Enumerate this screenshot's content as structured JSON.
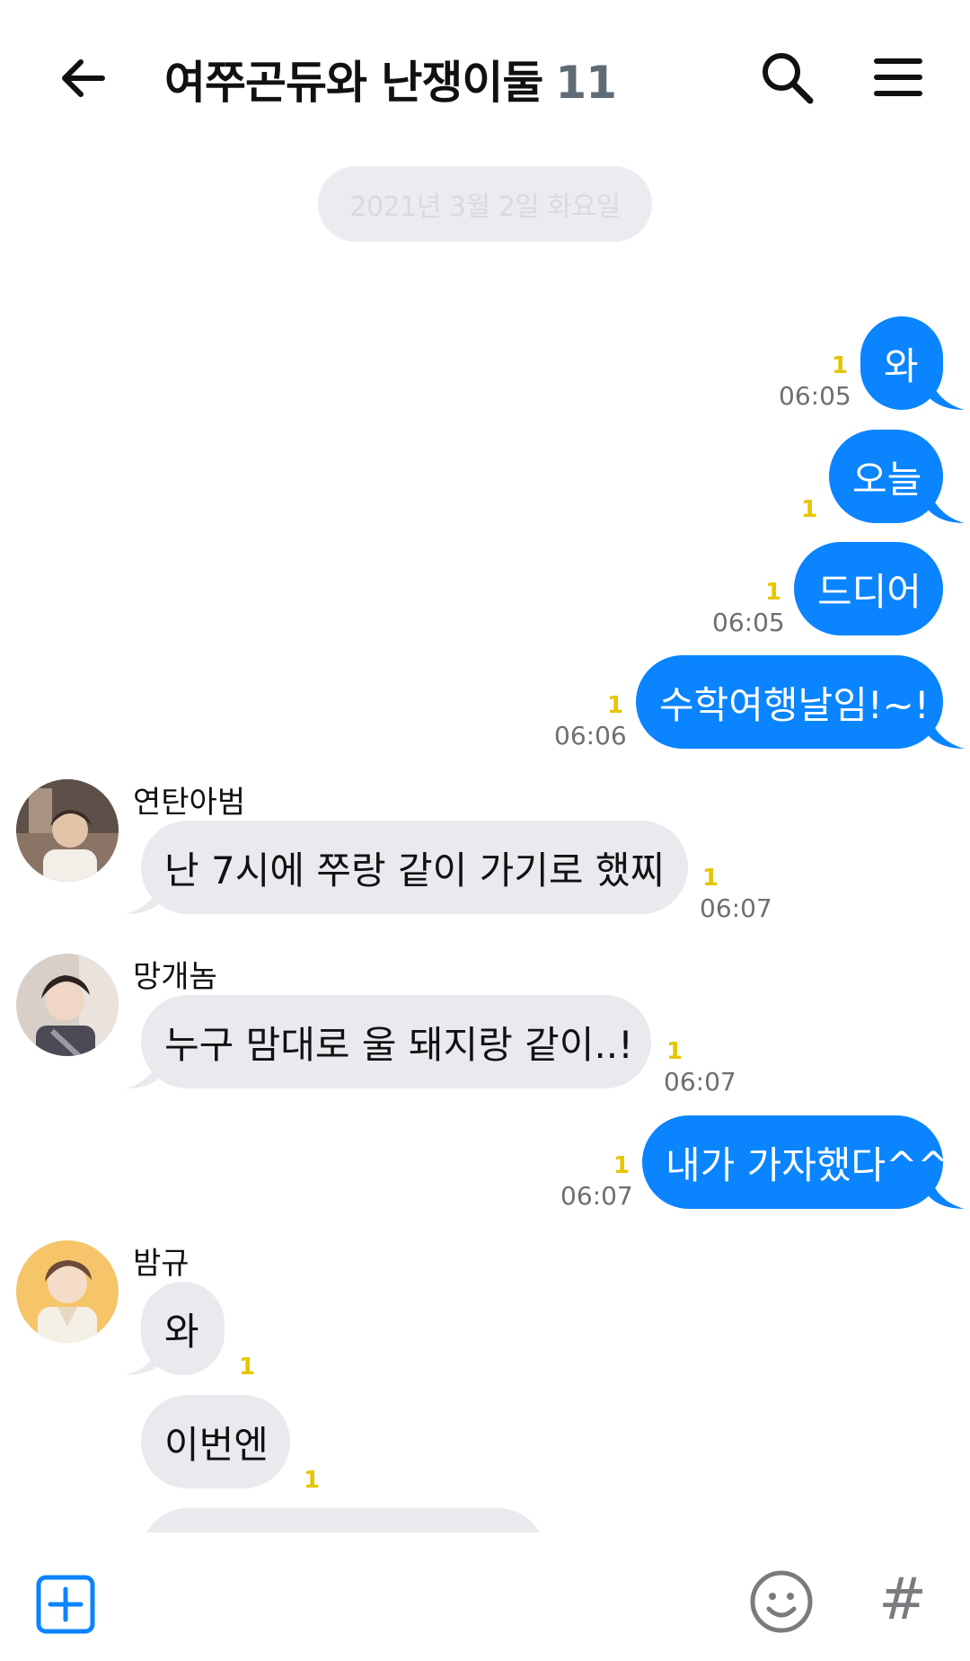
{
  "header": {
    "title": "여쭈곤듀와 난쟁이둘",
    "member_count": "11",
    "icons": [
      "back-arrow-icon",
      "search-icon",
      "menu-icon"
    ]
  },
  "date_divider": "2021년 3월 2일 화요일",
  "messages": [
    {
      "dir": "out",
      "text": "와",
      "unread": "1",
      "time": "06:05"
    },
    {
      "dir": "out",
      "text": "오늘",
      "unread": "1",
      "time": ""
    },
    {
      "dir": "out",
      "text": "드디어",
      "unread": "1",
      "time": "06:05"
    },
    {
      "dir": "out",
      "text": "수학여행날임!~!",
      "unread": "1",
      "time": "06:06"
    },
    {
      "dir": "in",
      "sender": "연탄아범",
      "text": "난 7시에 쭈랑 같이 가기로 했찌",
      "unread": "1",
      "time": "06:07"
    },
    {
      "dir": "in",
      "sender": "망개놈",
      "text": "누구 맘대로 울 돼지랑 같이..!",
      "unread": "1",
      "time": "06:07"
    },
    {
      "dir": "out",
      "text": "내가 가자했다^^",
      "unread": "1",
      "time": "06:07"
    },
    {
      "dir": "in",
      "sender": "밤규",
      "text": "와",
      "unread": "1",
      "time": ""
    },
    {
      "dir": "in",
      "text": "이번엔",
      "unread": "1",
      "time": ""
    }
  ],
  "inputbar": {
    "icons": [
      "plus-icon",
      "emoji-icon",
      "hashtag-icon"
    ],
    "hash_glyph": "#"
  },
  "colors": {
    "outgoing_bubble": "#0a84ff",
    "incoming_bubble": "#e9e9ee",
    "unread": "#e6c600",
    "accent": "#0a84ff"
  }
}
